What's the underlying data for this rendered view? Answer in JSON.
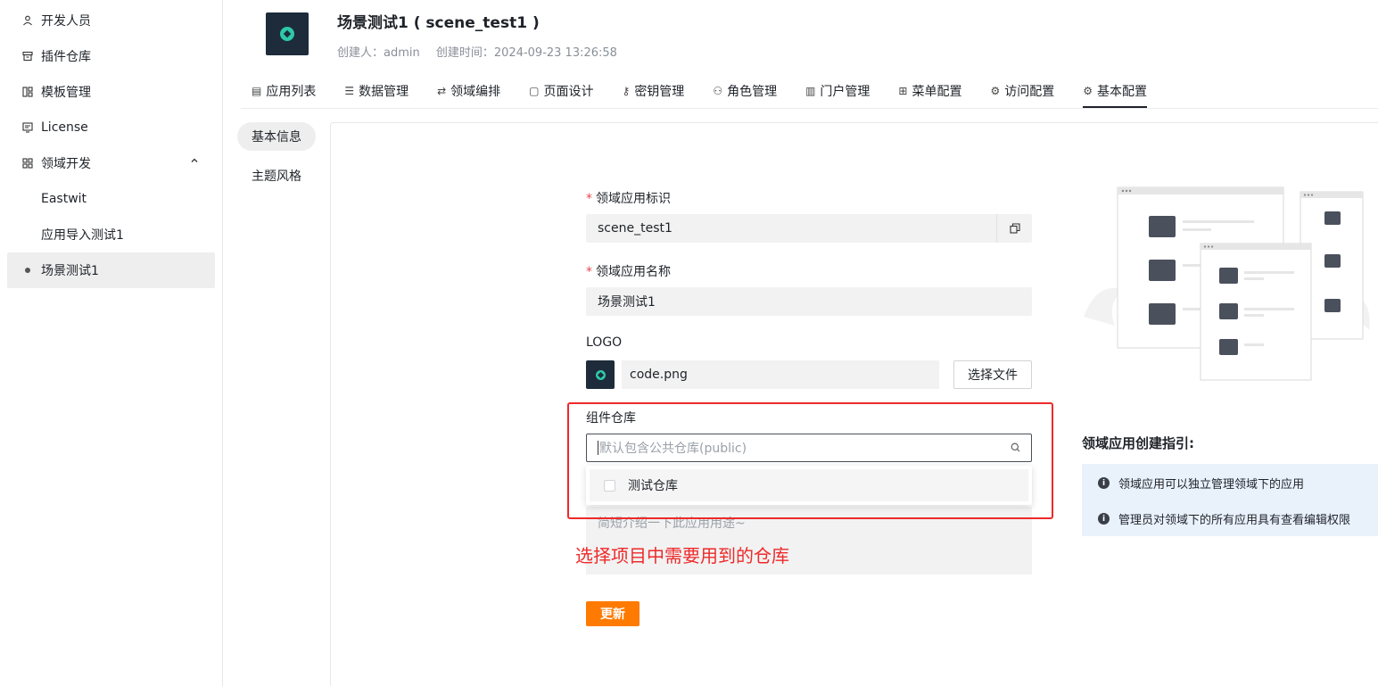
{
  "sidebar": {
    "items": [
      {
        "label": "开发人员",
        "icon": "user-icon"
      },
      {
        "label": "插件仓库",
        "icon": "archive-icon"
      },
      {
        "label": "模板管理",
        "icon": "template-icon"
      },
      {
        "label": "License",
        "icon": "license-icon"
      },
      {
        "label": "领域开发",
        "icon": "grid-icon"
      },
      {
        "label": "Eastwit"
      },
      {
        "label": "应用导入测试1"
      },
      {
        "label": "场景测试1"
      }
    ]
  },
  "header": {
    "title": "场景测试1 ( scene_test1 )",
    "creator": "创建人：admin",
    "created_time": "创建时间：2024-09-23 13:26:58"
  },
  "tabs": [
    {
      "label": "应用列表",
      "icon": "app-list-icon"
    },
    {
      "label": "数据管理",
      "icon": "database-icon"
    },
    {
      "label": "领域编排",
      "icon": "flow-icon"
    },
    {
      "label": "页面设计",
      "icon": "page-design-icon"
    },
    {
      "label": "密钥管理",
      "icon": "key-icon"
    },
    {
      "label": "角色管理",
      "icon": "role-icon"
    },
    {
      "label": "门户管理",
      "icon": "portal-icon"
    },
    {
      "label": "菜单配置",
      "icon": "menu-grid-icon"
    },
    {
      "label": "访问配置",
      "icon": "gear-icon"
    },
    {
      "label": "基本配置",
      "icon": "settings-icon"
    }
  ],
  "subnav": {
    "basic_info": "基本信息",
    "theme_style": "主题风格"
  },
  "form": {
    "id_label": "领域应用标识",
    "id_value": "scene_test1",
    "name_label": "领域应用名称",
    "name_value": "场景测试1",
    "logo_label": "LOGO",
    "logo_file": "code.png",
    "choose_file": "选择文件",
    "repo_label": "组件仓库",
    "repo_placeholder": "默认包含公共仓库(public)",
    "repo_option": "测试仓库",
    "desc_placeholder": "简短介绍一下此应用用途~",
    "update": "更新"
  },
  "annotation": "选择项目中需要用到的仓库",
  "guide": {
    "title": "领域应用创建指引:",
    "items": [
      "领域应用可以独立管理领域下的应用",
      "管理员对领域下的所有应用具有查看编辑权限"
    ]
  },
  "colors": {
    "accent": "#ff7a00",
    "annotation": "#ee2a2a",
    "logo_bg": "#1d2b3a",
    "logo_mark": "#2ec9a7"
  }
}
